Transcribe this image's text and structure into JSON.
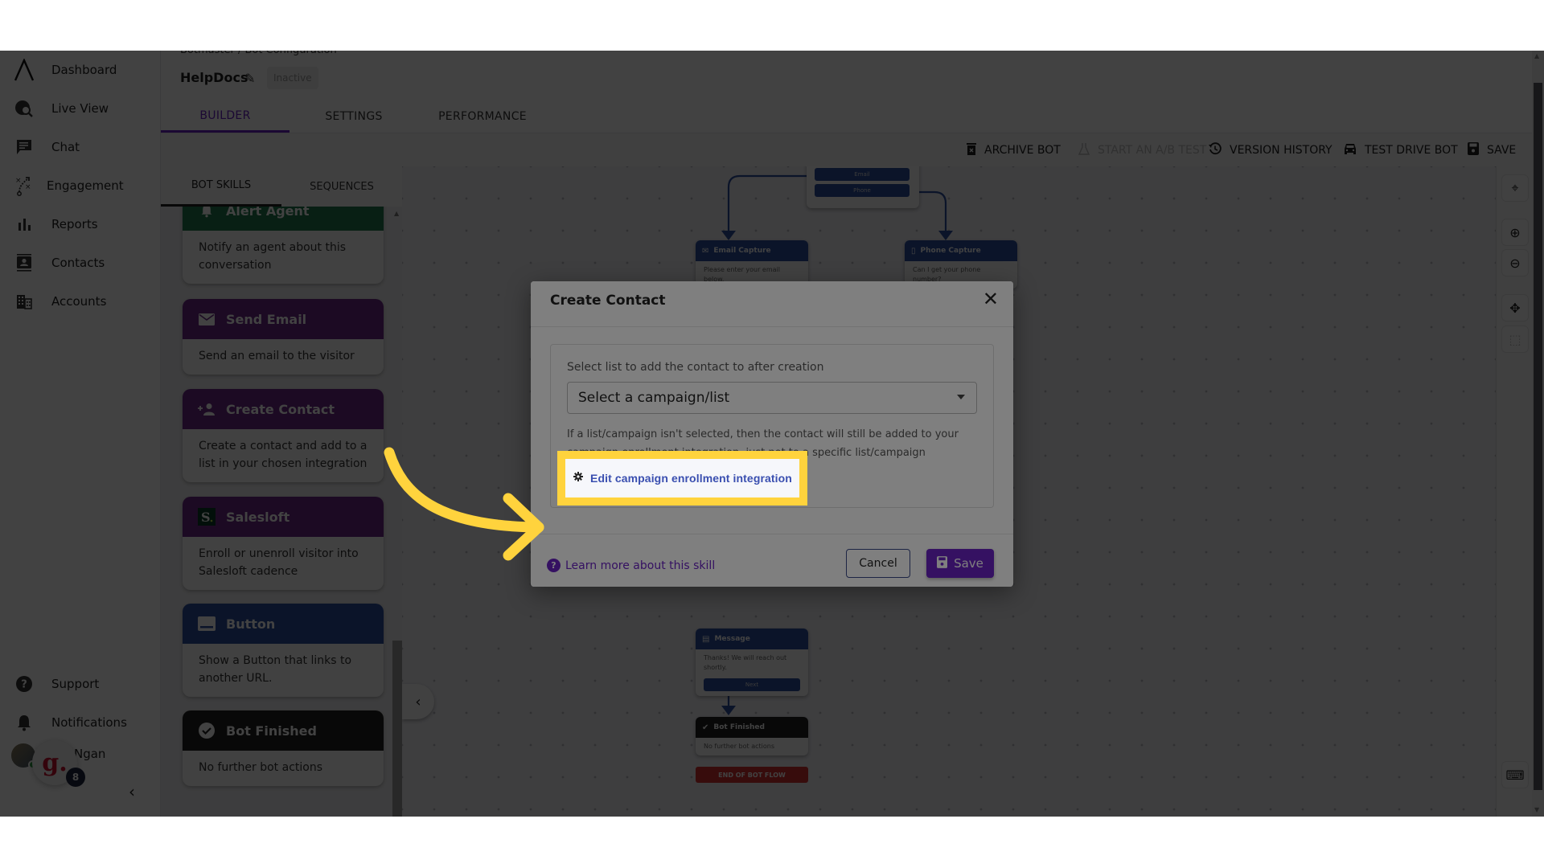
{
  "nav": {
    "items": [
      {
        "label": "Dashboard",
        "icon": "logo-caret-icon"
      },
      {
        "label": "Live View",
        "icon": "globe-search-icon"
      },
      {
        "label": "Chat",
        "icon": "chat-icon"
      },
      {
        "label": "Engagement",
        "icon": "strategy-icon"
      },
      {
        "label": "Reports",
        "icon": "bar-chart-icon"
      },
      {
        "label": "Contacts",
        "icon": "contact-card-icon"
      },
      {
        "label": "Accounts",
        "icon": "building-icon"
      }
    ],
    "bottom": [
      {
        "label": "Support",
        "icon": "help-circle-icon"
      },
      {
        "label": "Notifications",
        "icon": "bell-icon"
      }
    ],
    "user_name": "Ngan",
    "widget_letter": "g.",
    "widget_badge": "8",
    "collapse_glyph": "‹"
  },
  "header": {
    "breadcrumb": "Botmaster / Bot Configuration",
    "bot_name": "HelpDocs",
    "status": "Inactive",
    "tabs": [
      {
        "label": "BUILDER",
        "active": true
      },
      {
        "label": "SETTINGS",
        "active": false
      },
      {
        "label": "PERFORMANCE",
        "active": false
      }
    ]
  },
  "toolbar": {
    "archive": "ARCHIVE BOT",
    "ab_test": "START AN A/B TEST",
    "version_history": "VERSION HISTORY",
    "test_drive": "TEST DRIVE BOT",
    "save": "SAVE"
  },
  "skills_panel": {
    "tabs": [
      {
        "label": "BOT SKILLS",
        "active": true
      },
      {
        "label": "SEQUENCES",
        "active": false
      }
    ],
    "cards": [
      {
        "title": "Alert Agent",
        "description": "Notify an agent about this conversation",
        "color": "#1f7a4d",
        "icon": "bell-icon"
      },
      {
        "title": "Send Email",
        "description": "Send an email to the visitor",
        "color": "#6b2a86",
        "icon": "envelope-icon"
      },
      {
        "title": "Create Contact",
        "description": "Create a contact and add to a list in your chosen integration",
        "color": "#6b2a86",
        "icon": "add-person-icon"
      },
      {
        "title": "Salesloft",
        "description": "Enroll or unenroll visitor into Salesloft cadence",
        "color": "#6b2a86",
        "icon": "salesloft-logo-icon"
      },
      {
        "title": "Button",
        "description": "Show a Button that links to another URL.",
        "color": "#2d4fa0",
        "icon": "button-icon"
      },
      {
        "title": "Bot Finished",
        "description": "No further bot actions",
        "color": "#222222",
        "icon": "check-circle-icon"
      }
    ]
  },
  "canvas": {
    "choice_buttons": [
      "Email",
      "Phone"
    ],
    "nodes": {
      "email_capture": {
        "title": "Email Capture",
        "text": "Please enter your email below."
      },
      "phone_capture": {
        "title": "Phone Capture",
        "text": "Can I get your phone number?"
      },
      "message": {
        "title": "Message",
        "text": "Thanks! We will reach out shortly.",
        "button": "Next"
      },
      "bot_finished": {
        "title": "Bot Finished",
        "text": "No further bot actions"
      }
    },
    "end_label": "END OF BOT FLOW"
  },
  "modal": {
    "title": "Create Contact",
    "field_label": "Select list to add the contact to after creation",
    "select_placeholder": "Select a campaign/list",
    "help_text": "If a list/campaign isn't selected, then the contact will still be added to your campaign enrollment integration, just not to a specific list/campaign",
    "edit_integration": "Edit campaign enrollment integration",
    "learn_more": "Learn more about this skill",
    "cancel": "Cancel",
    "save": "Save"
  },
  "colors": {
    "accent": "#6a22c4",
    "highlight": "#ffd33d",
    "node_blue": "#2d4fa0",
    "end_red": "#d32f2f"
  }
}
